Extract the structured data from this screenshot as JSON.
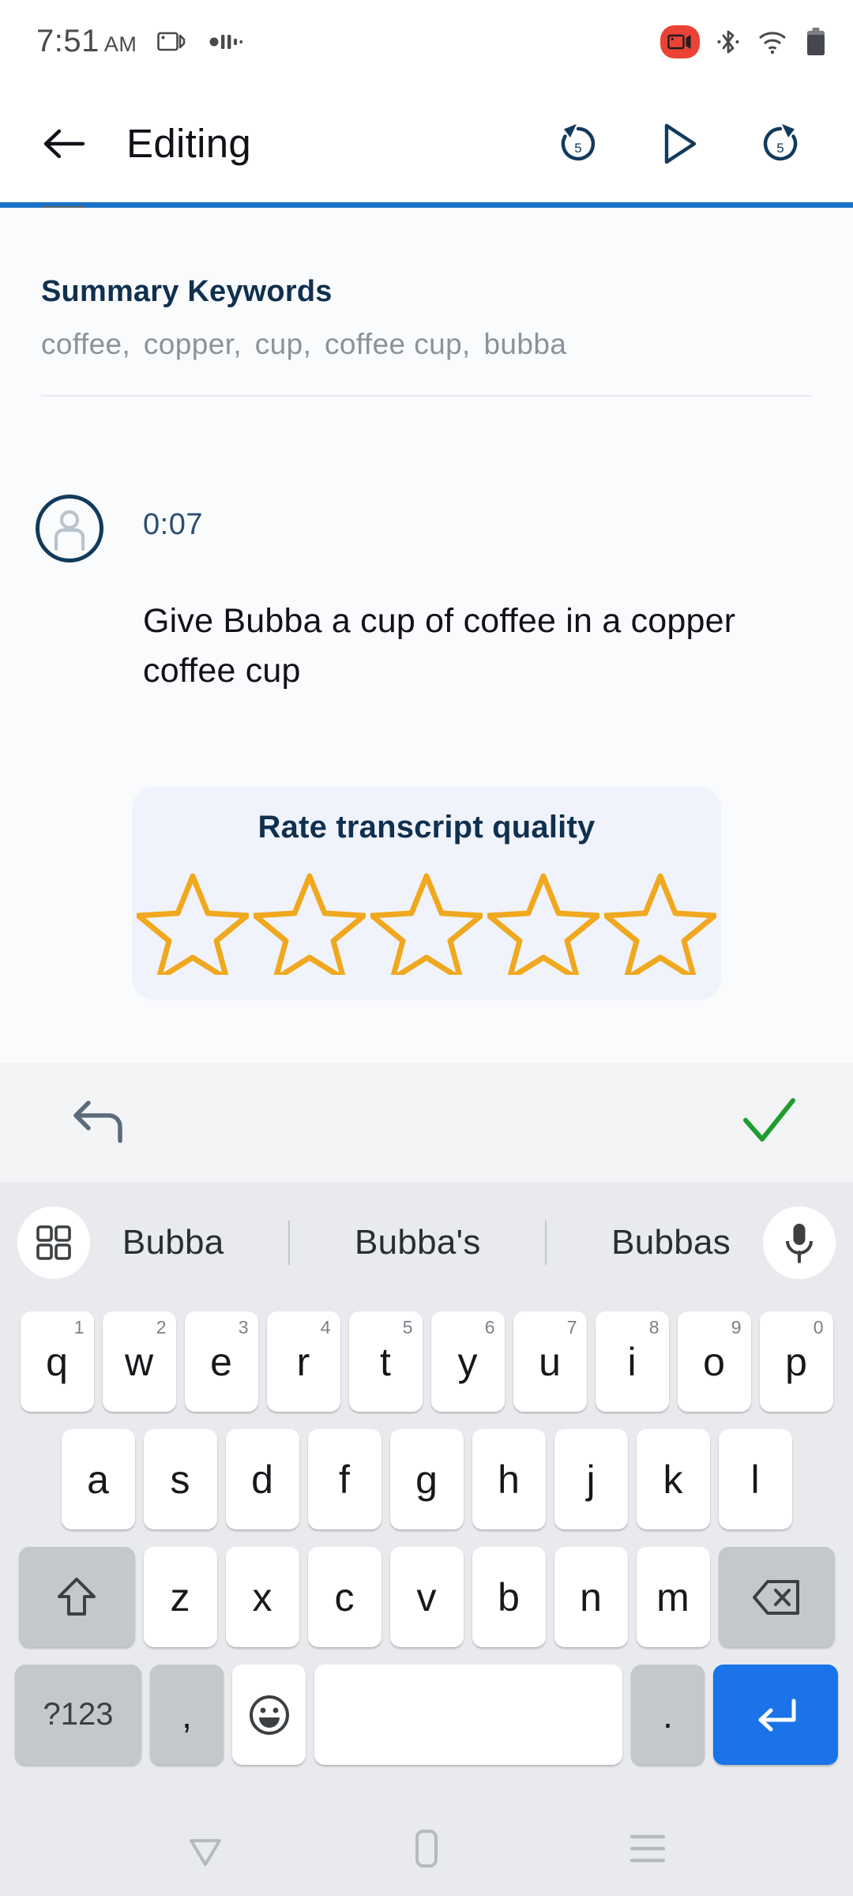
{
  "status_bar": {
    "time": "7:51",
    "ampm": "AM",
    "icons": [
      "screen-record-icon",
      "voice-recorder-icon",
      "video-call-recording-icon",
      "bluetooth-icon",
      "wifi-icon",
      "battery-icon"
    ]
  },
  "app_bar": {
    "back_label": "back-arrow",
    "title": "Editing",
    "rewind_label": "5",
    "play_label": "play",
    "forward_label": "5"
  },
  "content": {
    "keywords_title": "Summary Keywords",
    "keywords": [
      "coffee,",
      "copper,",
      "cup,",
      "coffee cup,",
      "bubba"
    ],
    "timestamp": "0:07",
    "transcript": "Give Bubba a cup of coffee in a copper coffee cup",
    "rate_card": {
      "title": "Rate transcript quality",
      "star_count": 5,
      "stars_filled": 0,
      "star_color": "#f0a81e",
      "card_bg": "#f0f3fb"
    }
  },
  "edit_toolbar": {
    "undo_label": "undo-icon",
    "confirm_label": "check-icon",
    "undo_color": "#5b6b7c",
    "confirm_color": "#1f9d2f"
  },
  "keyboard": {
    "suggestions": [
      "Bubba",
      "Bubba's",
      "Bubbas"
    ],
    "left_icon": "apps-grid-icon",
    "right_icon": "microphone-icon",
    "row1": [
      {
        "key": "q",
        "hint": "1"
      },
      {
        "key": "w",
        "hint": "2"
      },
      {
        "key": "e",
        "hint": "3"
      },
      {
        "key": "r",
        "hint": "4"
      },
      {
        "key": "t",
        "hint": "5"
      },
      {
        "key": "y",
        "hint": "6"
      },
      {
        "key": "u",
        "hint": "7"
      },
      {
        "key": "i",
        "hint": "8"
      },
      {
        "key": "o",
        "hint": "9"
      },
      {
        "key": "p",
        "hint": "0"
      }
    ],
    "row2": [
      "a",
      "s",
      "d",
      "f",
      "g",
      "h",
      "j",
      "k",
      "l"
    ],
    "row3": [
      "z",
      "x",
      "c",
      "v",
      "b",
      "n",
      "m"
    ],
    "shift_label": "shift-icon",
    "backspace_label": "backspace-icon",
    "num_key": "?123",
    "comma_key": ",",
    "emoji_key": "emoji-icon",
    "space_key": "",
    "period_key": ".",
    "enter_key": "enter-icon",
    "enter_color": "#1a73e8"
  },
  "nav_bar": {
    "back": "nav-back-icon",
    "home": "nav-home-icon",
    "recents": "nav-recents-icon"
  },
  "colors": {
    "accent_blue": "#1a73c8",
    "navy": "#10304f",
    "star_orange": "#f0a81e",
    "content_bg": "#fafbfd",
    "keyboard_bg": "#e8eaed"
  }
}
